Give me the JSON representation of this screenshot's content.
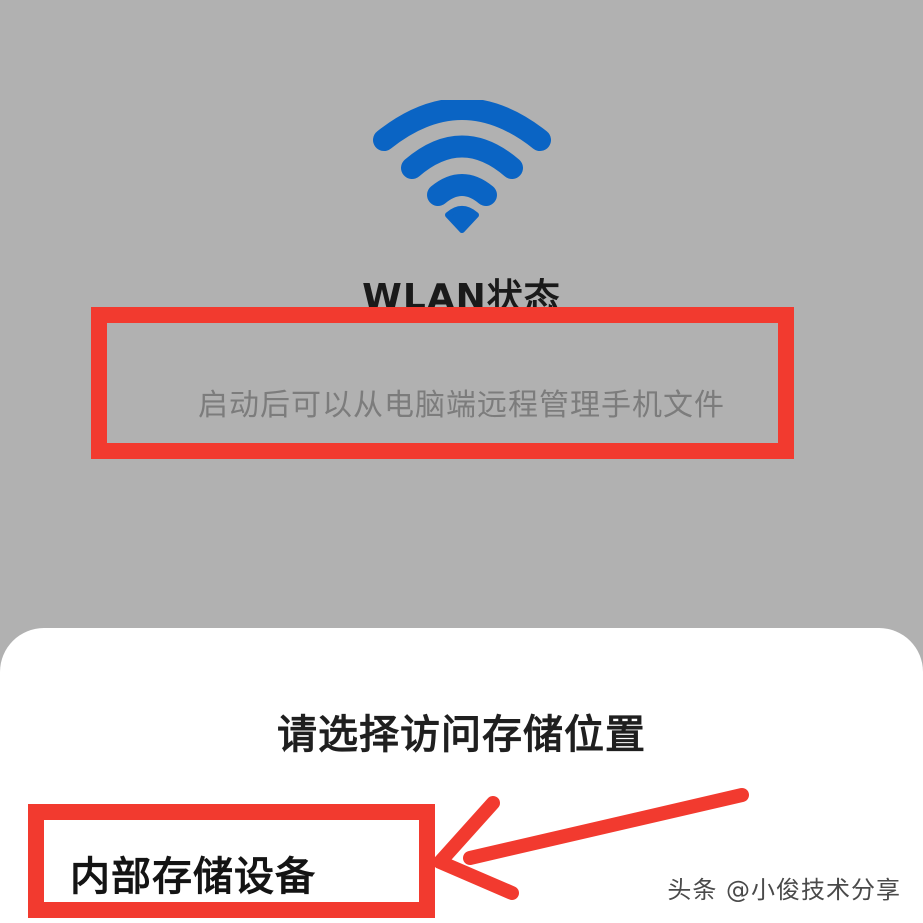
{
  "wifi_status": {
    "icon": "wifi-icon",
    "title": "WLAN状态",
    "description": "启动后可以从电脑端远程管理手机文件"
  },
  "storage_sheet": {
    "title": "请选择访问存储位置",
    "options": [
      {
        "label": "内部存储设备"
      }
    ]
  },
  "watermark": "头条 @小俊技术分享",
  "colors": {
    "background": "#b1b1b1",
    "wifi_blue": "#0a64c4",
    "annotation_red": "#f23a2f",
    "sheet": "#ffffff"
  }
}
